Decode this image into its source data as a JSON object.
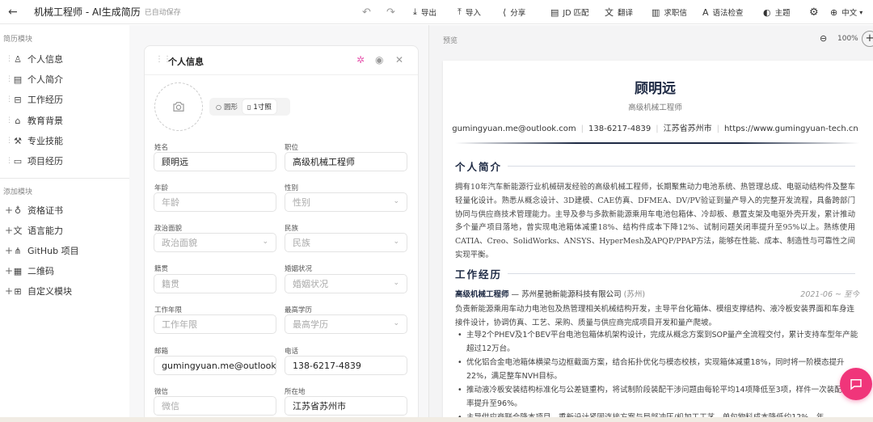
{
  "header": {
    "back_icon": "arrow-left-icon",
    "title": "机械工程师 - AI生成简历",
    "saved_status": "已自动保存",
    "toolbar": [
      {
        "name": "export",
        "icon": "download-icon",
        "label": "导出"
      },
      {
        "name": "import",
        "icon": "upload-icon",
        "label": "导入"
      },
      {
        "name": "share",
        "icon": "share-icon",
        "label": "分享"
      },
      {
        "name": "jd-match",
        "icon": "document-icon",
        "label": "JD 匹配"
      },
      {
        "name": "translate",
        "icon": "translate-icon",
        "label": "翻译"
      },
      {
        "name": "cover-letter",
        "icon": "letter-icon",
        "label": "求职信"
      },
      {
        "name": "grammar",
        "icon": "spellcheck-icon",
        "label": "语法检查"
      },
      {
        "name": "theme",
        "icon": "palette-icon",
        "label": "主题"
      }
    ],
    "language": "中文"
  },
  "sidebar": {
    "section_title": "简历模块",
    "items": [
      {
        "label": "个人信息",
        "icon": "user-icon"
      },
      {
        "label": "个人简介",
        "icon": "file-text-icon"
      },
      {
        "label": "工作经历",
        "icon": "briefcase-icon"
      },
      {
        "label": "教育背景",
        "icon": "graduation-cap-icon"
      },
      {
        "label": "专业技能",
        "icon": "wrench-icon"
      },
      {
        "label": "项目经历",
        "icon": "folder-icon"
      }
    ],
    "add_title": "添加模块",
    "add_items": [
      {
        "label": "资格证书",
        "icon": "award-icon"
      },
      {
        "label": "语言能力",
        "icon": "languages-icon"
      },
      {
        "label": "GitHub 项目",
        "icon": "code-icon"
      },
      {
        "label": "二维码",
        "icon": "qrcode-icon"
      },
      {
        "label": "自定义模块",
        "icon": "grid-plus-icon"
      }
    ]
  },
  "editor": {
    "card_title": "个人信息",
    "photo_shapes": [
      {
        "label": "圆形",
        "active": false
      },
      {
        "label": "1寸照",
        "active": true
      }
    ],
    "fields": [
      {
        "label": "姓名",
        "value": "顾明远",
        "placeholder": "",
        "dropdown": false
      },
      {
        "label": "职位",
        "value": "高级机械工程师",
        "placeholder": "",
        "dropdown": false
      },
      {
        "label": "年龄",
        "value": "",
        "placeholder": "年龄",
        "dropdown": false
      },
      {
        "label": "性别",
        "value": "",
        "placeholder": "性别",
        "dropdown": true
      },
      {
        "label": "政治面貌",
        "value": "",
        "placeholder": "政治面貌",
        "dropdown": true
      },
      {
        "label": "民族",
        "value": "",
        "placeholder": "民族",
        "dropdown": true
      },
      {
        "label": "籍贯",
        "value": "",
        "placeholder": "籍贯",
        "dropdown": false
      },
      {
        "label": "婚姻状况",
        "value": "",
        "placeholder": "婚姻状况",
        "dropdown": true
      },
      {
        "label": "工作年限",
        "value": "",
        "placeholder": "工作年限",
        "dropdown": false
      },
      {
        "label": "最高学历",
        "value": "",
        "placeholder": "最高学历",
        "dropdown": true
      },
      {
        "label": "邮箱",
        "value": "gumingyuan.me@outlook.",
        "placeholder": "",
        "dropdown": false
      },
      {
        "label": "电话",
        "value": "138-6217-4839",
        "placeholder": "",
        "dropdown": false
      },
      {
        "label": "微信",
        "value": "",
        "placeholder": "微信",
        "dropdown": false
      },
      {
        "label": "所在地",
        "value": "江苏省苏州市",
        "placeholder": "",
        "dropdown": false
      }
    ]
  },
  "preview": {
    "label": "预览",
    "zoom": "100%",
    "name": "顾明远",
    "role": "高级机械工程师",
    "contacts": [
      "gumingyuan.me@outlook.com",
      "138-6217-4839",
      "江苏省苏州市",
      "https://www.gumingyuan-tech.cn"
    ],
    "summary_title": "个人简介",
    "summary": "拥有10年汽车新能源行业机械研发经验的高级机械工程师，长期聚焦动力电池系统、热管理总成、电驱动结构件及整车轻量化设计。熟悉从概念设计、3D建模、CAE仿真、DFMEA、DV/PV验证到量产导入的完整开发流程，具备跨部门协同与供应商技术管理能力。主导及参与多款新能源乘用车电池包箱体、冷却板、悬置支架及电驱外壳开发，累计推动多个量产项目落地，曾实现电池箱体减重18%、结构件成本下降12%、试制问题关闭率提升至95%以上。熟练使用CATIA、Creo、SolidWorks、ANSYS、HyperMesh及APQP/PPAP方法，能够在性能、成本、制造性与可靠性之间实现平衡。",
    "experience_title": "工作经历",
    "job": {
      "title": "高级机械工程师",
      "dash": "—",
      "company": "苏州星驰新能源科技有限公司",
      "location": "(苏州)",
      "date": "2021-06 ~ 至今",
      "description": "负责新能源乘用车动力电池包及热管理相关机械结构开发，主导平台化箱体、模组支撑结构、液冷板安装界面和车身连接件设计，协调仿真、工艺、采购、质量与供应商完成项目开发和量产爬坡。",
      "bullets": [
        "主导2个PHEV及1个BEV平台电池包箱体机架构设计，完成从概念方案到SOP量产全流程交付，累计支持车型年产能超过12万台。",
        "优化铝合金电池箱体横梁与边框截面方案，结合拓扑优化与模态校核，实现箱体减重18%，同时将一阶模态提升22%，满足整车NVH目标。",
        "推动液冷板安装结构标准化与公差链重构，将试制阶段装配干涉问题由每轮平均14项降低至3项，样件一次装配通过率提升至96%。",
        "主导供应商联合降本项目，重新设计紧固连接方案与局部冲压/机加工工艺，单包物料成本降低约12%，年"
      ]
    }
  },
  "fab_icon": "chat-icon"
}
